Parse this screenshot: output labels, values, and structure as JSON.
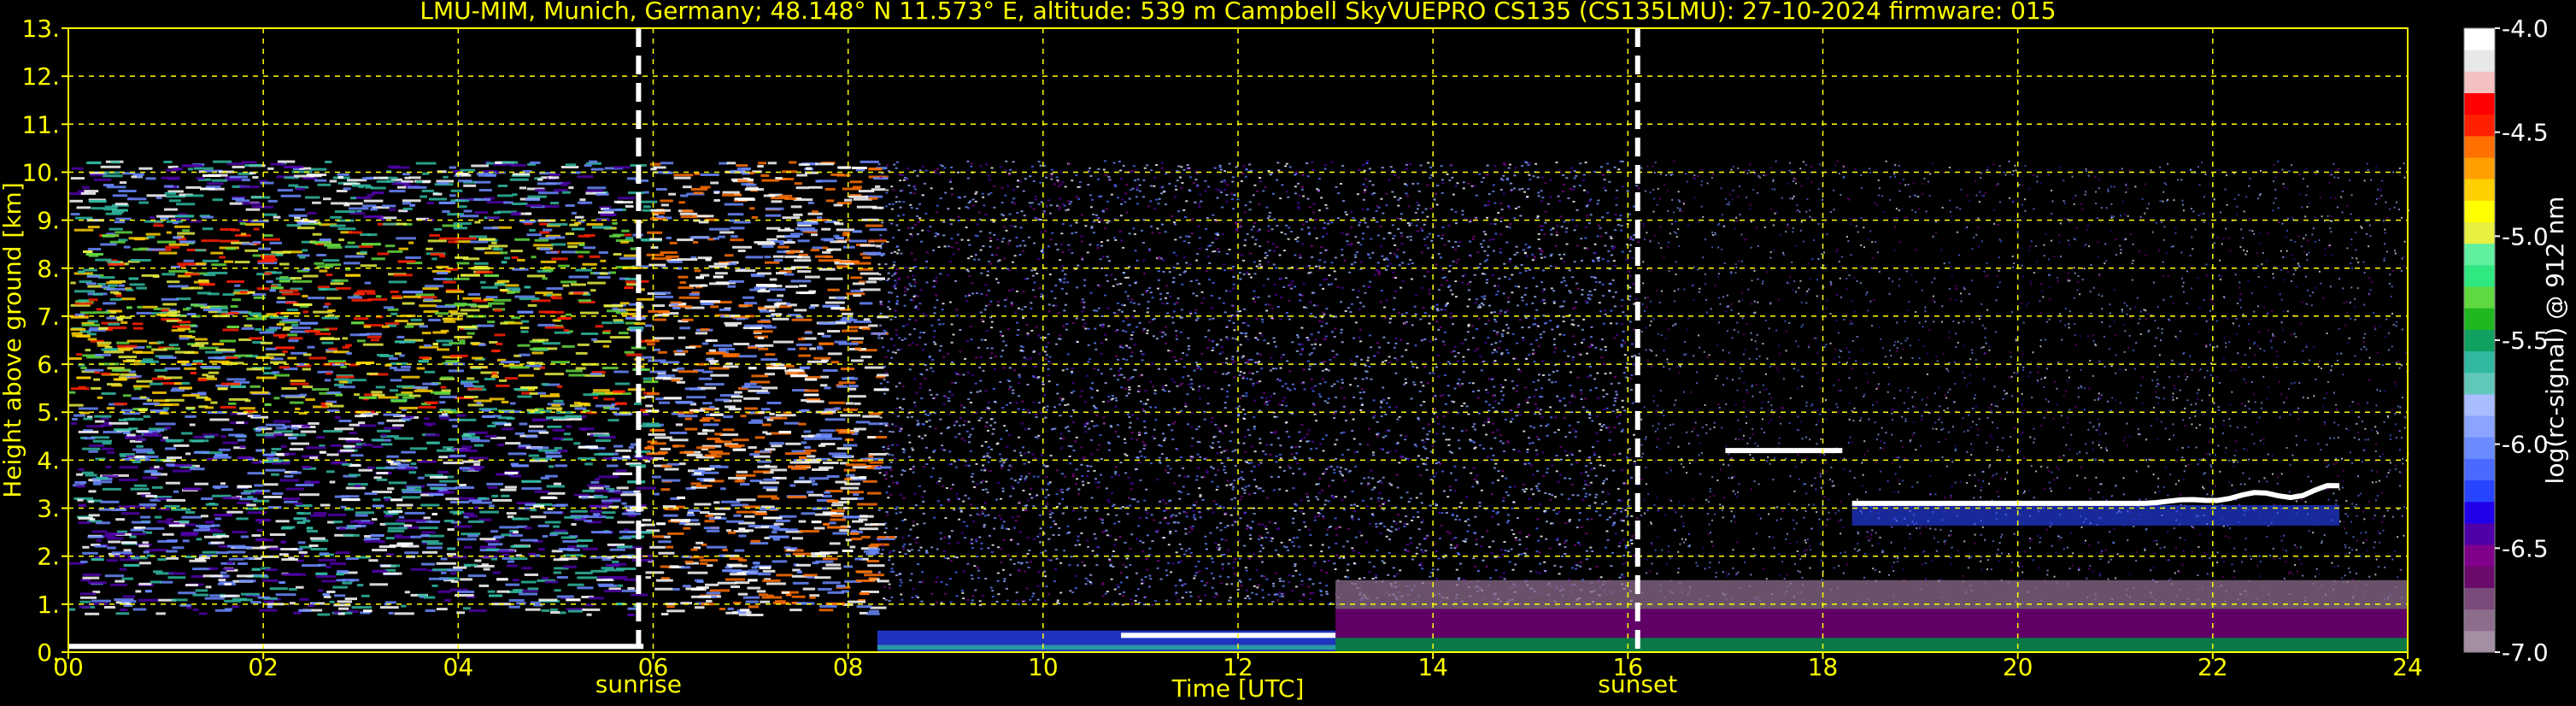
{
  "chart_data": {
    "type": "heatmap",
    "title": "LMU-MIM, Munich, Germany; 48.148° N 11.573° E, altitude: 539 m    Campbell SkyVUEPRO CS135 (CS135LMU): 27-10-2024    firmware: 015",
    "xlabel": "Time [UTC]",
    "ylabel": "Height above ground [km]",
    "xlim": [
      0,
      24
    ],
    "ylim": [
      0,
      13
    ],
    "x_ticks": [
      "00",
      "02",
      "04",
      "06",
      "08",
      "10",
      "12",
      "14",
      "16",
      "18",
      "20",
      "22",
      "24"
    ],
    "y_ticks": [
      "0.",
      "1.",
      "2.",
      "3.",
      "4.",
      "5.",
      "6.",
      "7.",
      "8.",
      "9.",
      "10.",
      "11.",
      "12.",
      "13."
    ],
    "grid": true,
    "annotations": [
      {
        "label": "sunrise",
        "x": 5.85
      },
      {
        "label": "sunset",
        "x": 16.1
      }
    ],
    "colorbar": {
      "label": "log(rc-signal) @ 912 nm",
      "range": [
        -7.0,
        -4.0
      ],
      "ticks": [
        "-4.0",
        "-4.5",
        "-5.0",
        "-5.5",
        "-6.0",
        "-6.5",
        "-7.0"
      ],
      "colors": [
        "#a48ea4",
        "#8c6e8c",
        "#7a4a7a",
        "#6a0a6a",
        "#80008a",
        "#5000a8",
        "#2000e8",
        "#2844ff",
        "#4a6aff",
        "#6a8aff",
        "#8aa4ff",
        "#a8bcff",
        "#60c8b8",
        "#30b8a0",
        "#10a060",
        "#20b820",
        "#60d840",
        "#30e880",
        "#60f0a0",
        "#e8f040",
        "#ffff00",
        "#ffd000",
        "#ffa000",
        "#ff7000",
        "#ff2000",
        "#ff0000",
        "#f4c0c0",
        "#e8e8e8",
        "#ffffff"
      ]
    },
    "features": [
      {
        "type": "boundary_layer_top",
        "x": [
          0,
          5.9
        ],
        "height_km": 0.12
      },
      {
        "type": "boundary_layer_top",
        "x": [
          10.8,
          13.0
        ],
        "height_km": 0.35
      },
      {
        "type": "cloud_layer",
        "x": [
          17.0,
          18.2
        ],
        "height_km": 4.2
      },
      {
        "type": "cloud_layer",
        "x": [
          18.3,
          23.3
        ],
        "height_km": 3.1,
        "top_km": 3.5
      }
    ]
  }
}
